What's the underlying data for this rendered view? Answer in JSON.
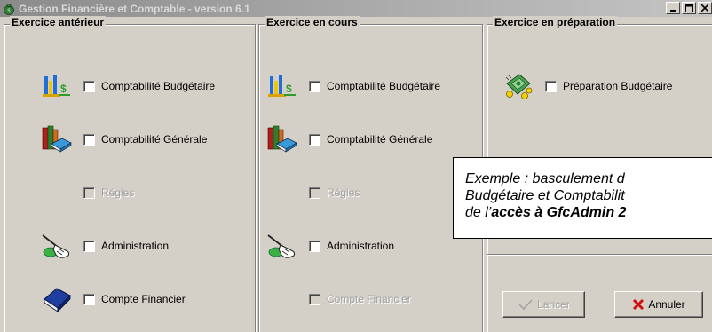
{
  "window": {
    "title": "Gestion Financière et Comptable - version 6.1",
    "title_icon": "money-bag-icon",
    "controls": [
      "minimize-icon",
      "maximize-icon",
      "close-icon"
    ]
  },
  "groups": {
    "anterieur": {
      "title": "Exercice antérieur",
      "items": [
        {
          "label": "Comptabilité Budgétaire",
          "icon": "budget-chart-icon",
          "enabled": true,
          "checked": false
        },
        {
          "label": "Comptabilité Générale",
          "icon": "books-icon",
          "enabled": true,
          "checked": false
        },
        {
          "label": "Régies",
          "icon": "",
          "enabled": false,
          "checked": false
        },
        {
          "label": "Administration",
          "icon": "pointing-hand-icon",
          "enabled": true,
          "checked": false
        },
        {
          "label": "Compte Financier",
          "icon": "blue-book-icon",
          "enabled": true,
          "checked": false
        }
      ]
    },
    "en_cours": {
      "title": "Exercice en cours",
      "items": [
        {
          "label": "Comptabilité Budgétaire",
          "icon": "budget-chart-icon",
          "enabled": true,
          "checked": false
        },
        {
          "label": "Comptabilité Générale",
          "icon": "books-icon",
          "enabled": true,
          "checked": false
        },
        {
          "label": "Régies",
          "icon": "",
          "enabled": false,
          "checked": false
        },
        {
          "label": "Administration",
          "icon": "pointing-hand-icon",
          "enabled": true,
          "checked": false
        },
        {
          "label": "Compte Financier",
          "icon": "",
          "enabled": false,
          "checked": false
        }
      ]
    },
    "preparation": {
      "title": "Exercice en préparation",
      "items": [
        {
          "label": "Préparation Budgétaire",
          "icon": "money-coins-icon",
          "enabled": true,
          "checked": false
        }
      ]
    }
  },
  "callout": {
    "line1": "Exemple : basculement d",
    "line2": "Budgétaire et Comptabilit",
    "line3_prefix": "de l’",
    "line3_bold": "accès à GfcAdmin 2"
  },
  "buttons": {
    "launch": {
      "label": "Lancer",
      "icon": "check-icon",
      "enabled": false
    },
    "cancel": {
      "label": "Annuler",
      "icon": "red-x-icon",
      "enabled": true
    }
  }
}
